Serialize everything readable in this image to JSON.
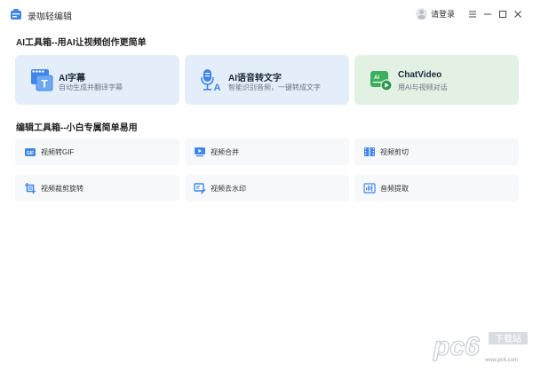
{
  "app": {
    "title": "录咖轻编辑"
  },
  "header": {
    "login_label": "请登录"
  },
  "window_controls": [
    "menu-icon",
    "minimize-icon",
    "maximize-icon",
    "close-icon"
  ],
  "ai_section": {
    "title": "AI工具箱--用AI让视频创作更简单",
    "cards": [
      {
        "title": "AI字幕",
        "subtitle": "自动生成并翻译字幕",
        "icon": "subtitle-icon",
        "bg": "#e4eefb"
      },
      {
        "title": "AI语音转文字",
        "subtitle": "智能识别音频，一键转成文字",
        "icon": "microphone-icon",
        "bg": "#e4eefb"
      },
      {
        "title": "ChatVideo",
        "subtitle": "用AI与视频对话",
        "icon": "ai-chat-video-icon",
        "bg": "#e2f1e4"
      }
    ]
  },
  "edit_section": {
    "title": "编辑工具箱--小白专属简单易用",
    "tools": [
      {
        "label": "视频转GIF",
        "icon": "gif-icon"
      },
      {
        "label": "视频合并",
        "icon": "merge-icon"
      },
      {
        "label": "视频剪切",
        "icon": "cut-icon"
      },
      {
        "label": "视频裁剪旋转",
        "icon": "crop-rotate-icon"
      },
      {
        "label": "视频去水印",
        "icon": "remove-watermark-icon"
      },
      {
        "label": "音频提取",
        "icon": "audio-extract-icon"
      }
    ]
  },
  "watermark": {
    "brand": "pc6",
    "tag": "下载站",
    "url": "www.pc6.com"
  },
  "colors": {
    "accent": "#3f86e8",
    "green": "#3aaf5c",
    "tool_bg": "#f7f8fa"
  }
}
